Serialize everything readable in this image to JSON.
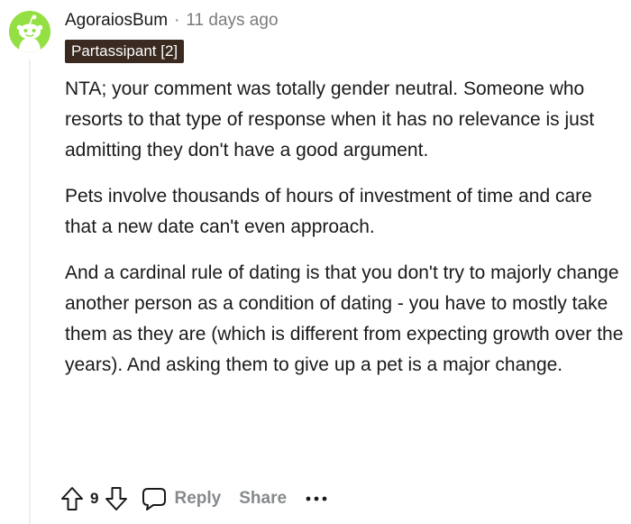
{
  "comment": {
    "username": "AgoraiosBum",
    "separator": "·",
    "timestamp": "11 days ago",
    "flair": "Partassipant [2]",
    "avatar_icon": "snoo-avatar-icon",
    "avatar_color": "#94e044",
    "paragraphs": [
      "NTA; your comment was totally gender neutral. Someone who resorts to that type of response when it has no relevance is just admitting they don't have a good argument.",
      "Pets involve thousands of hours of investment of time and care that a new date can't even approach.",
      "And a cardinal rule of dating is that you don't try to majorly change another person as a condition of dating - you have to mostly take them as they are (which is different from expecting growth over the years). And asking them to give up a pet is a major change."
    ],
    "actions": {
      "upvote_icon": "upvote-arrow-icon",
      "vote_count": "9",
      "downvote_icon": "downvote-arrow-icon",
      "reply_icon": "speech-bubble-icon",
      "reply_label": "Reply",
      "share_label": "Share",
      "more_icon": "ellipsis-icon"
    }
  }
}
